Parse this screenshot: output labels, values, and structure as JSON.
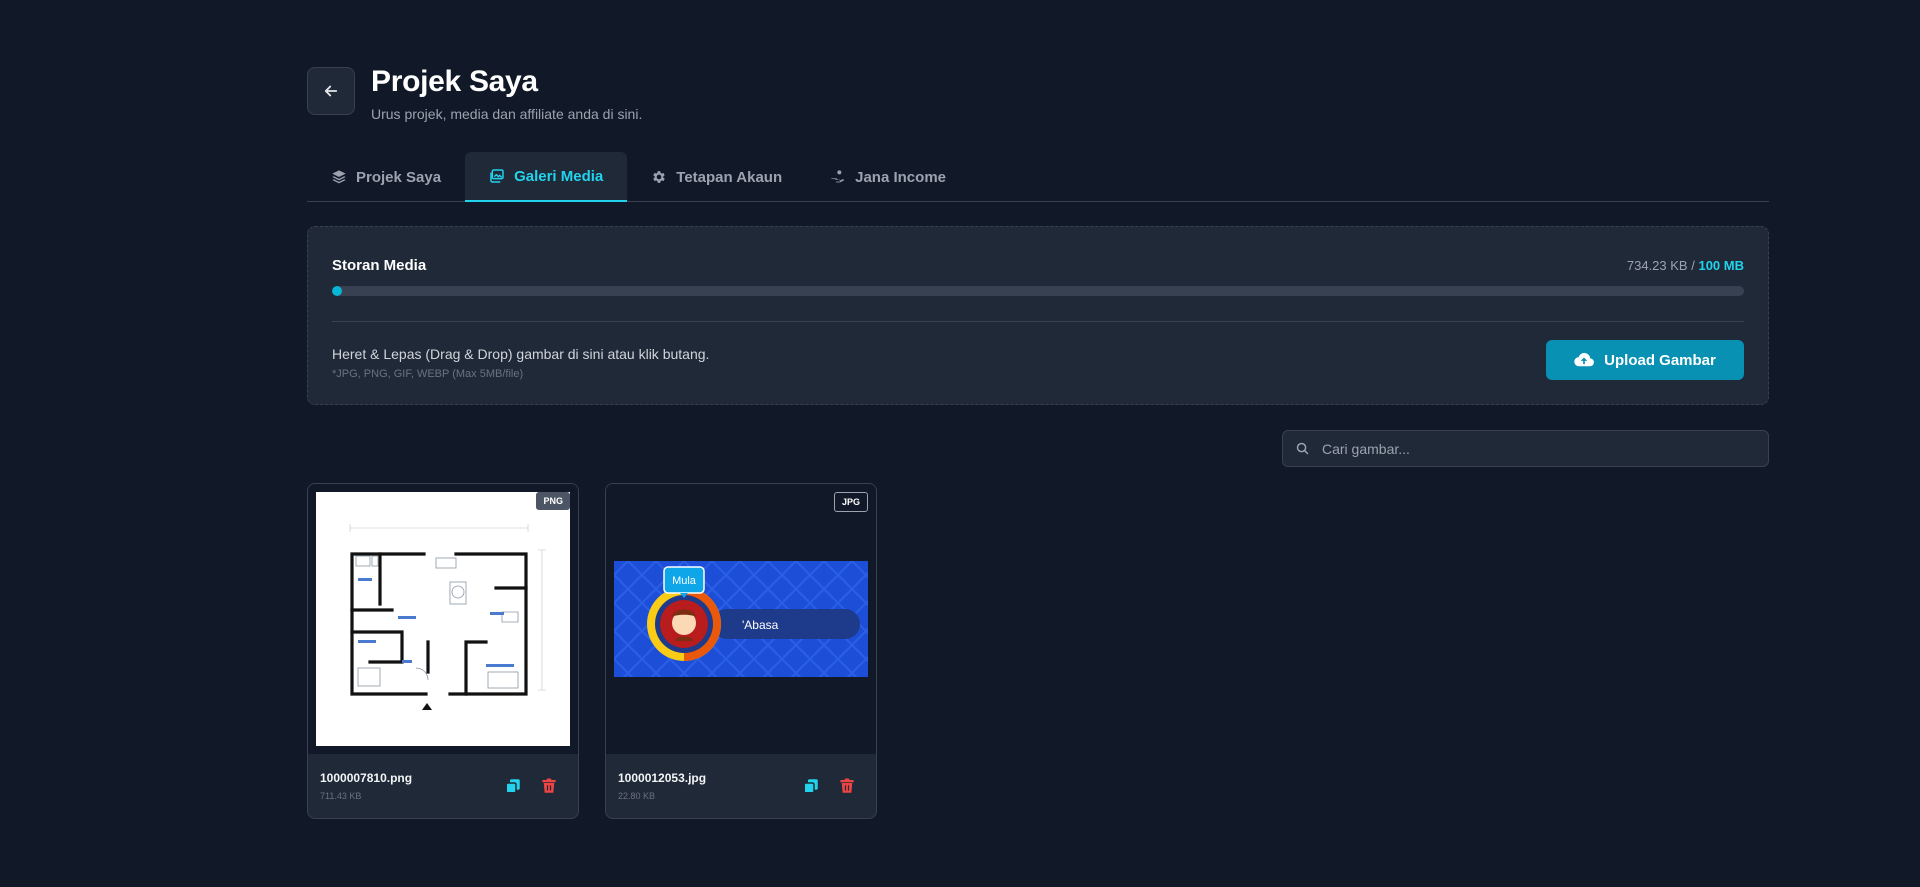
{
  "header": {
    "title": "Projek Saya",
    "subtitle": "Urus projek, media dan affiliate anda di sini."
  },
  "tabs": [
    {
      "label": "Projek Saya",
      "icon": "layers-icon",
      "active": false
    },
    {
      "label": "Galeri Media",
      "icon": "image-gallery-icon",
      "active": true
    },
    {
      "label": "Tetapan Akaun",
      "icon": "gear-icon",
      "active": false
    },
    {
      "label": "Jana Income",
      "icon": "hand-coin-icon",
      "active": false
    }
  ],
  "storage": {
    "label": "Storan Media",
    "used": "734.23 KB",
    "separator": "/",
    "max": "100 MB",
    "used_fraction": 0.0072,
    "upload_text": "Heret & Lepas (Drag & Drop) gambar di sini atau klik butang.",
    "upload_hint": "*JPG, PNG, GIF, WEBP (Max 5MB/file)",
    "upload_button": "Upload Gambar"
  },
  "search": {
    "placeholder": "Cari gambar..."
  },
  "media": [
    {
      "name": "1000007810.png",
      "size": "711.43 KB",
      "badge": "PNG"
    },
    {
      "name": "1000012053.jpg",
      "size": "22.80 KB",
      "badge": "JPG",
      "banner_badge": "Mula",
      "banner_text": "'Abasa"
    }
  ],
  "colors": {
    "background": "#111827",
    "surface": "#1f2937",
    "accent": "#22d3ee",
    "button": "#0891b2",
    "danger": "#ef4444"
  }
}
